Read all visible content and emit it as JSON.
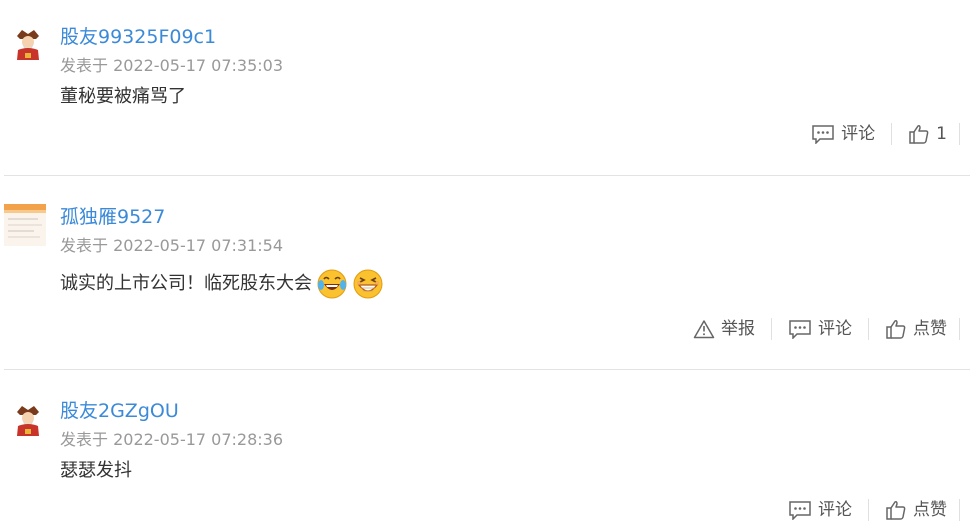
{
  "comments": [
    {
      "username": "股友99325F09c1",
      "timestamp": "发表于 2022-05-17 07:35:03",
      "text": "董秘要被痛骂了",
      "avatar_icon": "fortune-god-avatar",
      "actions": {
        "comment": "评论",
        "like": "1"
      }
    },
    {
      "username": "孤独雁9527",
      "timestamp": "发表于 2022-05-17 07:31:54",
      "text": "诚实的上市公司！临死股东大会",
      "avatar_icon": "landscape-photo-avatar",
      "emojis": [
        "laughing-tears-emoji",
        "grinning-emoji"
      ],
      "actions": {
        "report": "举报",
        "comment": "评论",
        "like": "点赞"
      }
    },
    {
      "username": "股友2GZgOU",
      "timestamp": "发表于 2022-05-17 07:28:36",
      "text": "瑟瑟发抖",
      "avatar_icon": "fortune-god-avatar",
      "actions": {
        "comment": "评论",
        "like": "点赞"
      }
    }
  ],
  "colors": {
    "username": "#3b8ad9",
    "timestamp": "#999999",
    "text": "#333333",
    "action": "#555555",
    "divider": "#e3e3e3"
  }
}
